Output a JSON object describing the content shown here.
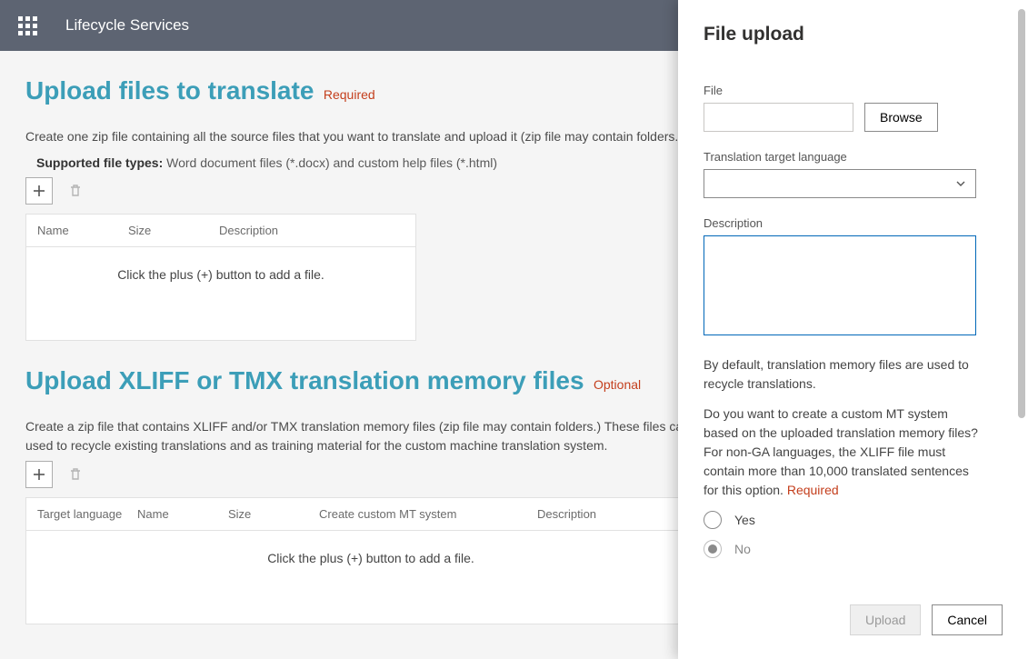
{
  "header": {
    "app_title": "Lifecycle Services"
  },
  "section1": {
    "title": "Upload files to translate",
    "tag": "Required",
    "desc": "Create one zip file containing all the source files that you want to translate and upload it (zip file may contain folders.)",
    "supported_label": "Supported file types:",
    "supported_value": "Word document files (*.docx) and custom help files (*.html)",
    "grid": {
      "col_name": "Name",
      "col_size": "Size",
      "col_desc": "Description",
      "empty": "Click the plus (+) button to add a file."
    }
  },
  "section2": {
    "title": "Upload XLIFF or TMX translation memory files",
    "tag": "Optional",
    "desc": "Create a zip file that contains XLIFF and/or TMX translation memory files (zip file may contain folders.) These files can be used to recycle existing translations and as training material for the custom machine translation system.",
    "grid": {
      "col_target": "Target language",
      "col_name": "Name",
      "col_size": "Size",
      "col_mt": "Create custom MT system",
      "col_desc": "Description",
      "empty": "Click the plus (+) button to add a file."
    }
  },
  "panel": {
    "title": "File upload",
    "file_label": "File",
    "browse": "Browse",
    "lang_label": "Translation target language",
    "desc_label": "Description",
    "desc_value": "",
    "info1": "By default, translation memory files are used to recycle translations.",
    "info2": "Do you want to create a custom MT system based on the uploaded translation memory files? For non-GA languages, the XLIFF file must contain more than 10,000 translated sentences for this option.",
    "required": "Required",
    "radio_yes": "Yes",
    "radio_no": "No",
    "upload": "Upload",
    "cancel": "Cancel"
  }
}
